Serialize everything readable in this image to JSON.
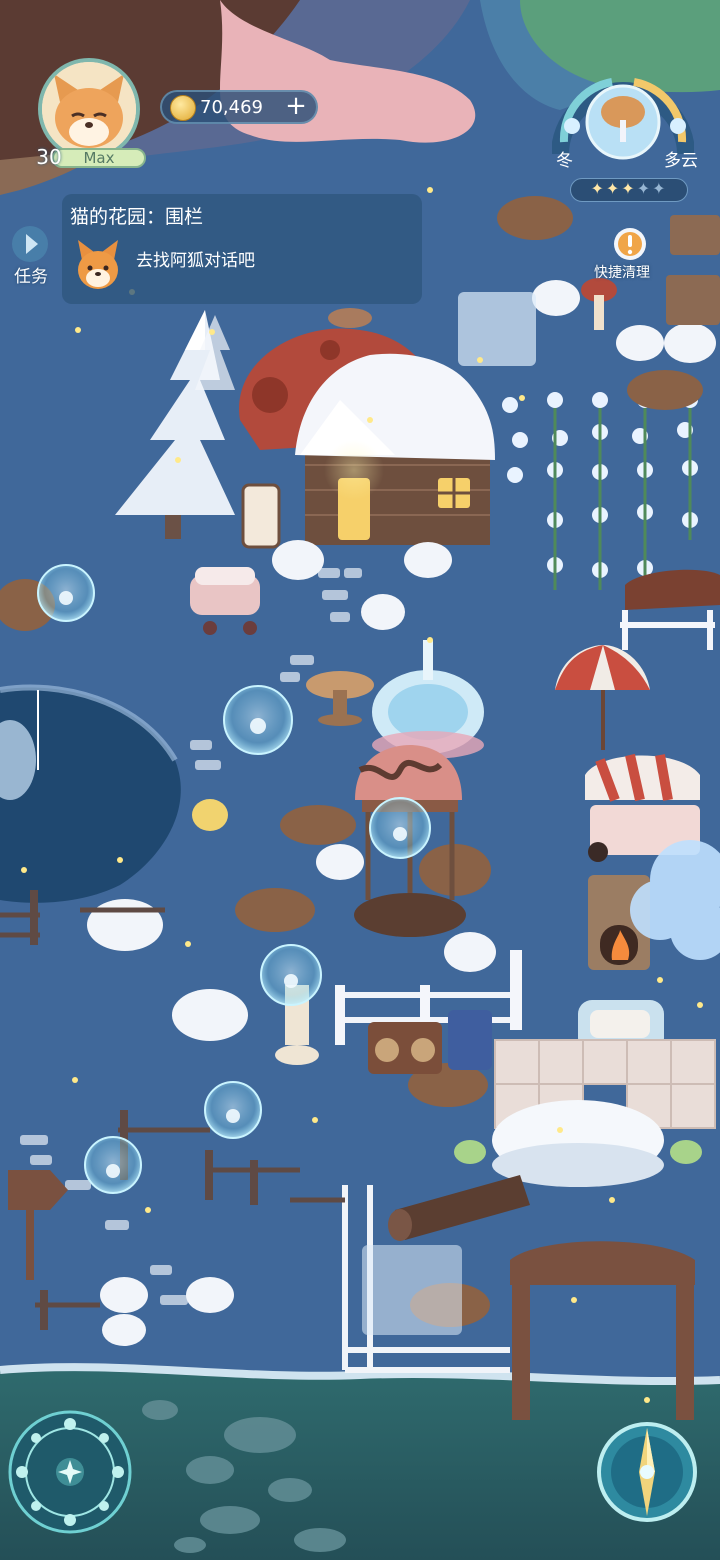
{
  "player": {
    "level": "30",
    "name": "Max",
    "avatar_icon": "fox-face-icon"
  },
  "currency": {
    "coins": "70,469",
    "coin_icon": "gold-coin-icon",
    "add_icon": "plus-icon"
  },
  "quest": {
    "title": "猫的花园：围栏",
    "description": "去找阿狐对话吧",
    "npc_icon": "fox-npc-icon",
    "toggle_label": "任务"
  },
  "weather": {
    "season": "冬",
    "condition": "多云",
    "stars_filled": 3,
    "stars_total": 5,
    "star_glyphs_on": "✦✦✦",
    "star_glyphs_off": "✦✦"
  },
  "quick_clean": {
    "label": "快捷清理",
    "badge": "!"
  },
  "colors": {
    "ground": "#3f6797",
    "snow": "#f3f6fb",
    "water": "#1f4870",
    "accent_teal": "#7fb7ad",
    "coin_gold": "#e0a930"
  }
}
